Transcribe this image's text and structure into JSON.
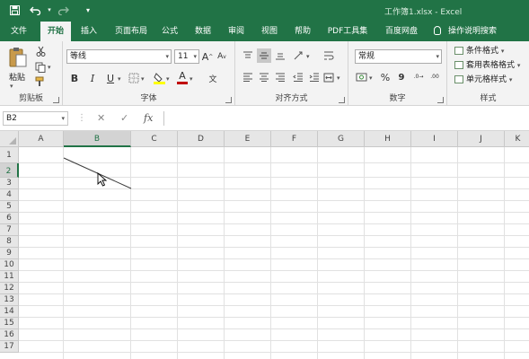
{
  "window": {
    "title": "工作簿1.xlsx  -  Excel"
  },
  "quick_access": {
    "save_icon": "save-icon",
    "undo_icon": "undo-icon",
    "redo_icon": "redo-icon",
    "customize_icon": "customize-icon"
  },
  "tabs": [
    {
      "label": "文件"
    },
    {
      "label": "开始"
    },
    {
      "label": "插入"
    },
    {
      "label": "页面布局"
    },
    {
      "label": "公式"
    },
    {
      "label": "数据"
    },
    {
      "label": "审阅"
    },
    {
      "label": "视图"
    },
    {
      "label": "帮助"
    },
    {
      "label": "PDF工具集"
    },
    {
      "label": "百度网盘"
    }
  ],
  "active_tab": "开始",
  "tell_me": "操作说明搜索",
  "ribbon": {
    "clipboard": {
      "group_label": "剪贴板",
      "paste_label": "粘贴"
    },
    "font": {
      "group_label": "字体",
      "font_name": "等线",
      "font_size": "11",
      "grow": "A",
      "shrink": "A",
      "bold": "B",
      "italic": "I",
      "underline": "U",
      "font_color_letter": "A",
      "phonetic": "文"
    },
    "alignment": {
      "group_label": "对齐方式"
    },
    "number": {
      "group_label": "数字",
      "format": "常规",
      "percent": "%",
      "comma": "9",
      "dec_inc": ".0→",
      "dec_dec": ".00"
    },
    "styles": {
      "group_label": "样式",
      "conditional": "条件格式",
      "table": "套用表格格式",
      "cell": "单元格样式"
    }
  },
  "formula_bar": {
    "name_box": "B2",
    "cancel": "✕",
    "enter": "✓",
    "fx": "fx",
    "value": ""
  },
  "sheet": {
    "columns": [
      "A",
      "B",
      "C",
      "D",
      "E",
      "F",
      "G",
      "H",
      "I",
      "J",
      "K"
    ],
    "rows": [
      "1",
      "2",
      "3",
      "4",
      "5",
      "6",
      "7",
      "8",
      "9",
      "10",
      "11",
      "12",
      "13",
      "14",
      "15",
      "16",
      "17"
    ],
    "selected_cell": "B2"
  },
  "colors": {
    "accent": "#217346",
    "ribbon": "#f3f3f3",
    "header": "#e6e6e6"
  }
}
